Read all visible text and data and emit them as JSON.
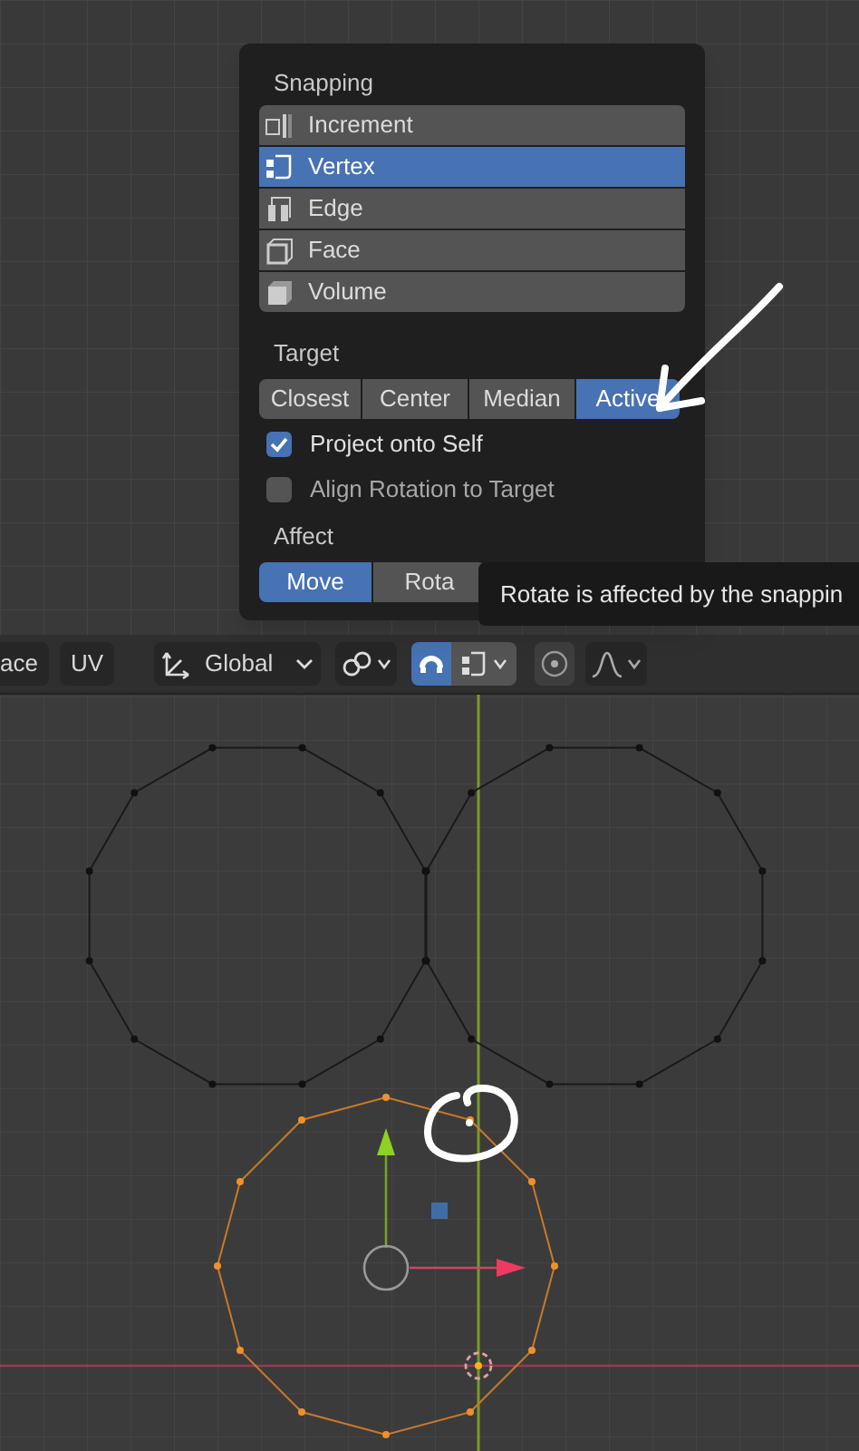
{
  "popup": {
    "snapping": {
      "title": "Snapping",
      "items": [
        {
          "label": "Increment",
          "kind": "increment",
          "selected": false
        },
        {
          "label": "Vertex",
          "kind": "vertex",
          "selected": true
        },
        {
          "label": "Edge",
          "kind": "edge",
          "selected": false
        },
        {
          "label": "Face",
          "kind": "face",
          "selected": false
        },
        {
          "label": "Volume",
          "kind": "volume",
          "selected": false
        }
      ]
    },
    "target": {
      "title": "Target",
      "options": [
        {
          "label": "Closest",
          "selected": false
        },
        {
          "label": "Center",
          "selected": false
        },
        {
          "label": "Median",
          "selected": false
        },
        {
          "label": "Active",
          "selected": true
        }
      ]
    },
    "checkboxes": [
      {
        "label": "Project onto Self",
        "checked": true
      },
      {
        "label": "Align Rotation to Target",
        "checked": false
      }
    ],
    "affect": {
      "title": "Affect",
      "options": [
        {
          "label": "Move",
          "selected": true
        },
        {
          "label": "Rota",
          "selected": false
        }
      ]
    }
  },
  "tooltip": {
    "text": "Rotate is affected by the snappin"
  },
  "header": {
    "mode_buttons": [
      "ace",
      "UV"
    ],
    "orientation": "Global",
    "snap": {
      "on": true
    },
    "proportional_editing": {
      "on": false
    }
  }
}
